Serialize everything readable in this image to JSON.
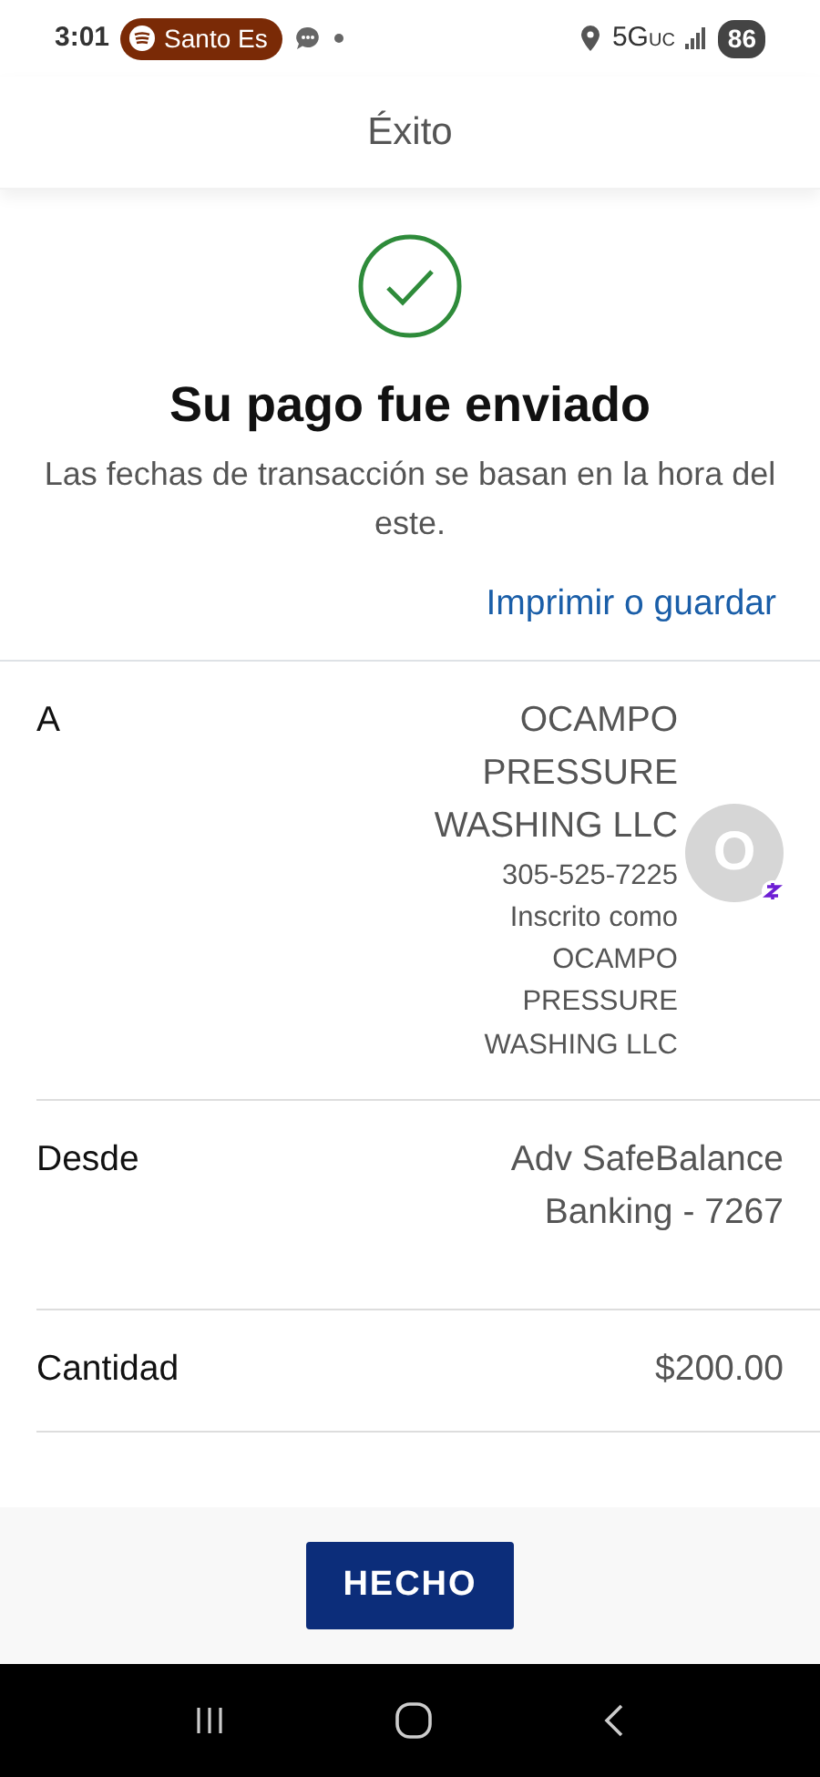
{
  "status_bar": {
    "time": "3:01",
    "media_pill": "Santo Es",
    "network": "5G",
    "network_suffix": "UC",
    "battery": "86"
  },
  "header": {
    "title": "Éxito"
  },
  "confirmation": {
    "title": "Su pago fue enviado",
    "subtitle": "Las fechas de transacción se basan en la hora del este.",
    "print_link": "Imprimir o guardar"
  },
  "details": [
    {
      "kind": "recipient",
      "label": "A",
      "name": "OCAMPO PRESSURE WASHING LLC",
      "phone": "305-525-7225",
      "enrolled_label": "Inscrito como",
      "enrolled_name": "OCAMPO PRESSURE WASHING LLC",
      "avatar": "O"
    },
    {
      "kind": "text",
      "label": "Desde",
      "value": "Adv SafeBalance Banking - 7267"
    },
    {
      "kind": "text",
      "label": "Cantidad",
      "value": "$200.00"
    }
  ],
  "footer": {
    "button": "HECHO"
  }
}
